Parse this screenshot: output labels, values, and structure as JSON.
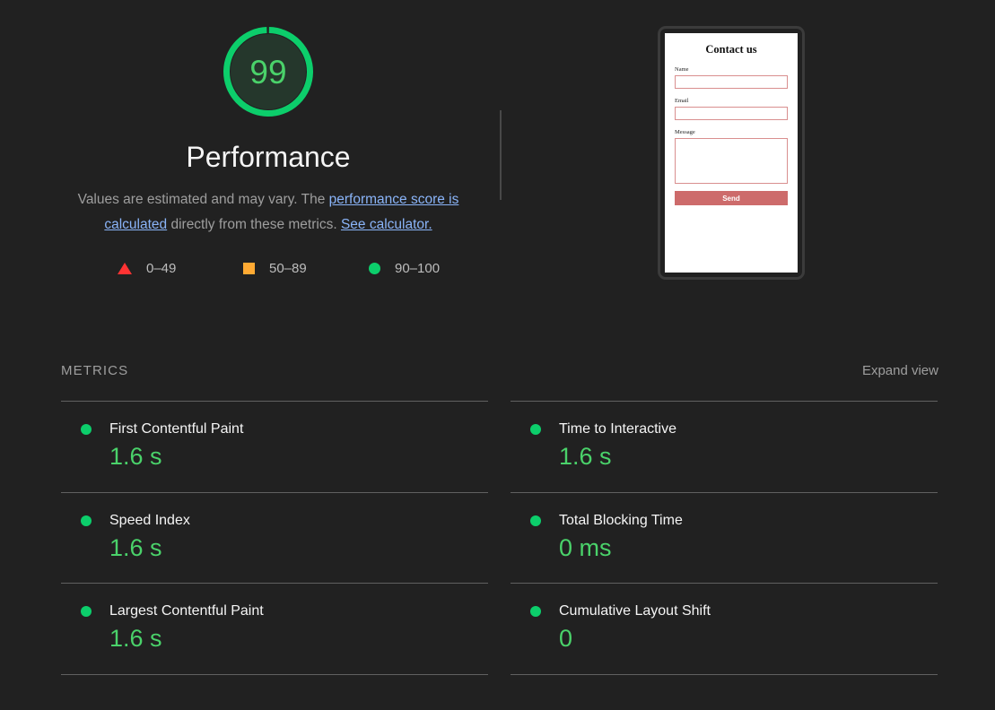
{
  "score_gauge": {
    "score": "99",
    "score_number": 99,
    "category": "Performance",
    "arc_color": "#0cce6b",
    "fill_color": "#25372c",
    "score_color": "#4ad26a"
  },
  "disclaimer": {
    "text_1": "Values are estimated and may vary. The ",
    "link_1": "performance score is calculated",
    "text_2": " directly from these metrics. ",
    "link_2": "See calculator.",
    "link_color": "#8ab4f8"
  },
  "legend": {
    "items": [
      {
        "icon": "triangle-fail-icon",
        "label": "0–49",
        "color": "#ff3333"
      },
      {
        "icon": "square-average-icon",
        "label": "50–89",
        "color": "#ffaa33"
      },
      {
        "icon": "circle-pass-icon",
        "label": "90–100",
        "color": "#0cce6b"
      }
    ]
  },
  "final_screenshot": {
    "title": "Contact us",
    "fields": [
      {
        "label": "Name",
        "value": ""
      },
      {
        "label": "Email",
        "value": ""
      },
      {
        "label": "Message",
        "value": ""
      }
    ],
    "submit_label": "Send",
    "submit_color": "#cd6b6b",
    "input_border_color": "#d98f8f"
  },
  "metrics": {
    "heading": "METRICS",
    "expand_label": "Expand view",
    "left_column": [
      {
        "name": "First Contentful Paint",
        "value": "1.6 s",
        "rating": "pass"
      },
      {
        "name": "Speed Index",
        "value": "1.6 s",
        "rating": "pass"
      },
      {
        "name": "Largest Contentful Paint",
        "value": "1.6 s",
        "rating": "pass"
      }
    ],
    "right_column": [
      {
        "name": "Time to Interactive",
        "value": "1.6 s",
        "rating": "pass"
      },
      {
        "name": "Total Blocking Time",
        "value": "0 ms",
        "rating": "pass"
      },
      {
        "name": "Cumulative Layout Shift",
        "value": "0",
        "rating": "pass"
      }
    ],
    "pass_color": "#0cce6b",
    "value_color": "#4ad26a"
  }
}
